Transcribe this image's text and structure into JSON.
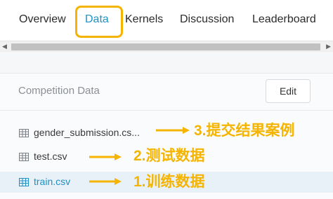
{
  "tabs": [
    {
      "label": "Overview"
    },
    {
      "label": "Data"
    },
    {
      "label": "Kernels"
    },
    {
      "label": "Discussion"
    },
    {
      "label": "Leaderboard"
    }
  ],
  "panel": {
    "title": "Competition Data",
    "edit_label": "Edit"
  },
  "files": [
    {
      "name": "gender_submission.cs..."
    },
    {
      "name": "test.csv"
    },
    {
      "name": "train.csv"
    }
  ],
  "annotations": [
    {
      "text": "3.提交结果案例"
    },
    {
      "text": "2.测试数据"
    },
    {
      "text": "1.训练数据"
    }
  ],
  "colors": {
    "accent": "#1f93c5",
    "highlight": "#f5b400",
    "selected_row": "#e8f1f8"
  }
}
